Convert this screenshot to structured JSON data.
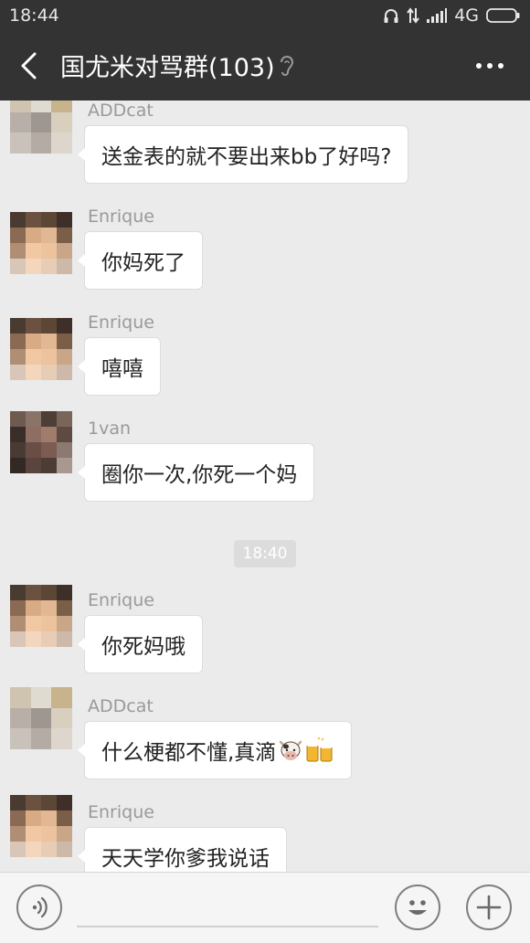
{
  "status_bar": {
    "time": "18:44",
    "network": "4G",
    "icons": [
      "headphones-icon",
      "data-transfer-icon",
      "signal-icon",
      "battery-icon"
    ]
  },
  "header": {
    "title": "国尤米对骂群(103)",
    "back_icon": "back-arrow-icon",
    "ear_icon": "earpiece-icon",
    "more_icon": "more-icon"
  },
  "messages": [
    {
      "sender": "ADDcat",
      "text": "送金表的就不要出来bb了好吗?"
    },
    {
      "sender": "Enrique",
      "text": "你妈死了"
    },
    {
      "sender": "Enrique",
      "text": "嘻嘻"
    },
    {
      "sender": "1van",
      "text": "圈你一次,你死一个妈"
    },
    {
      "timestamp": "18:40"
    },
    {
      "sender": "Enrique",
      "text": "你死妈哦"
    },
    {
      "sender": "ADDcat",
      "text": "什么梗都不懂,真滴",
      "emojis": [
        "cow-emoji-icon",
        "beer-emoji-icon"
      ]
    },
    {
      "sender": "Enrique",
      "text": "天天学你爹我说话"
    }
  ],
  "input_bar": {
    "voice_icon": "voice-icon",
    "emoji_icon": "emoji-icon",
    "plus_icon": "plus-icon",
    "value": ""
  },
  "colors": {
    "header_bg": "#333333",
    "chat_bg": "#ebebeb",
    "bubble_bg": "#ffffff",
    "sender_text": "#9a9a9a"
  }
}
